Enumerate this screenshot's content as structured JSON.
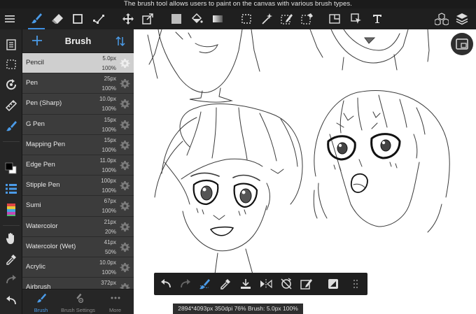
{
  "caption": "The brush tool allows users to paint on the canvas with various brush types.",
  "panel": {
    "title": "Brush",
    "brushes": [
      {
        "name": "Pencil",
        "size": "5.0px",
        "opacity": "100%",
        "selected": true
      },
      {
        "name": "Pen",
        "size": "25px",
        "opacity": "100%"
      },
      {
        "name": "Pen (Sharp)",
        "size": "10.0px",
        "opacity": "100%"
      },
      {
        "name": "G Pen",
        "size": "15px",
        "opacity": "100%"
      },
      {
        "name": "Mapping Pen",
        "size": "15px",
        "opacity": "100%"
      },
      {
        "name": "Edge Pen",
        "size": "11.0px",
        "opacity": "100%"
      },
      {
        "name": "Stipple Pen",
        "size": "100px",
        "opacity": "100%"
      },
      {
        "name": "Sumi",
        "size": "67px",
        "opacity": "100%"
      },
      {
        "name": "Watercolor",
        "size": "21px",
        "opacity": "20%"
      },
      {
        "name": "Watercolor (Wet)",
        "size": "41px",
        "opacity": "50%"
      },
      {
        "name": "Acrylic",
        "size": "10.0px",
        "opacity": "100%"
      },
      {
        "name": "Airbrush",
        "size": "372px",
        "opacity": ""
      }
    ],
    "tabs": [
      {
        "label": "Brush",
        "icon": "brush-icon",
        "active": true
      },
      {
        "label": "Brush Settings",
        "icon": "brush-settings-icon"
      },
      {
        "label": "More",
        "icon": "more-icon"
      }
    ]
  },
  "status": "2894*4093px 350dpi 76% Brush: 5.0px 100%",
  "colors": {
    "accent": "#3d8ee0",
    "toolbar_bg": "#1f1f1f",
    "panel_bg": "#2e2e2e",
    "selected_row": "#cfcfcf",
    "primary_color": "#000000",
    "secondary_color": "#ffffff"
  }
}
